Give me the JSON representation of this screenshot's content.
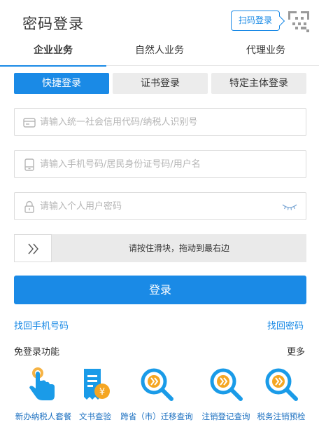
{
  "header": {
    "title": "密码登录",
    "qr_login_label": "扫码登录",
    "qr_icon": "qr-code-icon"
  },
  "tabs": [
    {
      "label": "企业业务",
      "active": true
    },
    {
      "label": "自然人业务",
      "active": false
    },
    {
      "label": "代理业务",
      "active": false
    }
  ],
  "subtabs": [
    {
      "label": "快捷登录",
      "active": true
    },
    {
      "label": "证书登录",
      "active": false
    },
    {
      "label": "特定主体登录",
      "active": false
    }
  ],
  "fields": {
    "credit_code": {
      "placeholder": "请输入统一社会信用代码/纳税人识别号",
      "value": "",
      "icon": "id-card-icon"
    },
    "account": {
      "placeholder": "请输入手机号码/居民身份证号码/用户名",
      "value": "",
      "icon": "phone-icon"
    },
    "password": {
      "placeholder": "请输入个人用户密码",
      "value": "",
      "icon": "lock-icon",
      "toggle_icon": "eye-closed-icon"
    }
  },
  "slider": {
    "text": "请按住滑块，拖动到最右边",
    "icon": "double-chevron-right-icon"
  },
  "login_button": "登录",
  "links": {
    "recover_phone": "找回手机号码",
    "recover_password": "找回密码"
  },
  "nologin": {
    "title": "免登录功能",
    "more": "更多",
    "items": [
      {
        "label": "新办纳税人套餐",
        "icon": "hand-tap-icon"
      },
      {
        "label": "文书查验",
        "icon": "document-yen-icon"
      },
      {
        "label": "跨省（市）迁移查询",
        "icon": "search-forward-icon"
      },
      {
        "label": "注销登记查询",
        "icon": "search-forward-icon"
      },
      {
        "label": "税务注销预检",
        "icon": "search-forward-icon"
      }
    ]
  },
  "colors": {
    "primary": "#1a8ae6",
    "icon_orange": "#f5a623",
    "icon_blue": "#1a9be8"
  }
}
